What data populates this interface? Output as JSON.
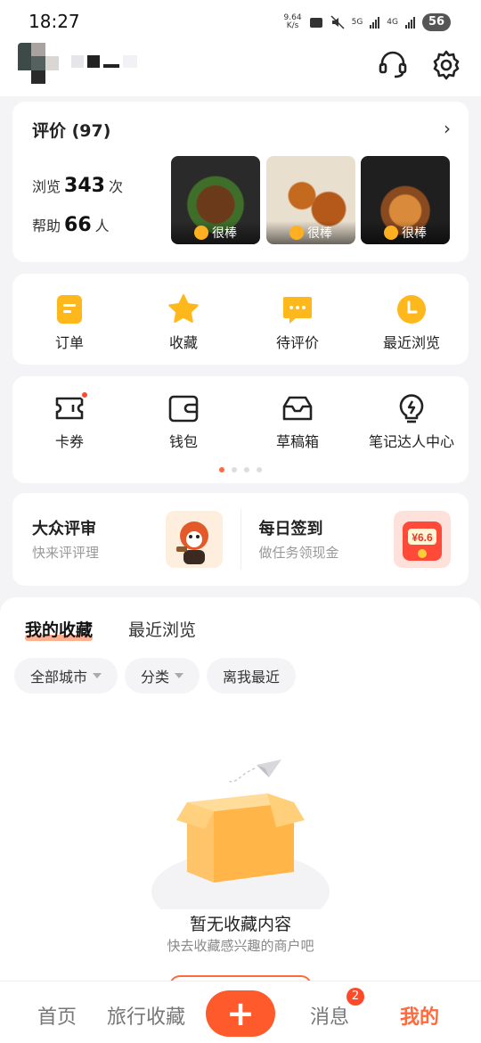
{
  "status_bar": {
    "time": "18:27",
    "net_speed_value": "9.64",
    "net_speed_unit": "K/s",
    "signal1_label": "5G",
    "signal2_label": "4G",
    "battery": "56"
  },
  "header": {
    "support_icon": "headset-icon",
    "settings_icon": "gear-icon"
  },
  "reviews": {
    "title": "评价 (97)",
    "views_label": "浏览",
    "views_count": "343",
    "views_unit": "次",
    "helps_label": "帮助",
    "helps_count": "66",
    "helps_unit": "人",
    "photos": [
      {
        "tag": "很棒"
      },
      {
        "tag": "很棒"
      },
      {
        "tag": "很棒"
      }
    ]
  },
  "menu1": [
    {
      "label": "订单",
      "icon": "order-icon"
    },
    {
      "label": "收藏",
      "icon": "star-icon"
    },
    {
      "label": "待评价",
      "icon": "comment-icon"
    },
    {
      "label": "最近浏览",
      "icon": "clock-icon"
    }
  ],
  "menu2": [
    {
      "label": "卡券",
      "icon": "coupon-icon"
    },
    {
      "label": "钱包",
      "icon": "wallet-icon"
    },
    {
      "label": "草稿箱",
      "icon": "drafts-icon"
    },
    {
      "label": "笔记达人中心",
      "icon": "lightbulb-icon"
    }
  ],
  "promos": [
    {
      "title": "大众评审",
      "subtitle": "快来评评理"
    },
    {
      "title": "每日签到",
      "subtitle": "做任务领现金",
      "badge": "¥6.6"
    }
  ],
  "collections": {
    "tabs": [
      "我的收藏",
      "最近浏览"
    ],
    "filters": [
      "全部城市",
      "分类",
      "离我最近"
    ],
    "empty_title": "暂无收藏内容",
    "empty_subtitle": "快去收藏感兴趣的商户吧"
  },
  "bottom_nav": {
    "home": "首页",
    "travel": "旅行收藏",
    "plus": "+",
    "messages": "消息",
    "messages_badge": "2",
    "mine": "我的"
  },
  "colors": {
    "accent": "#ff6a3d",
    "icon_yellow": "#ffb81c"
  }
}
